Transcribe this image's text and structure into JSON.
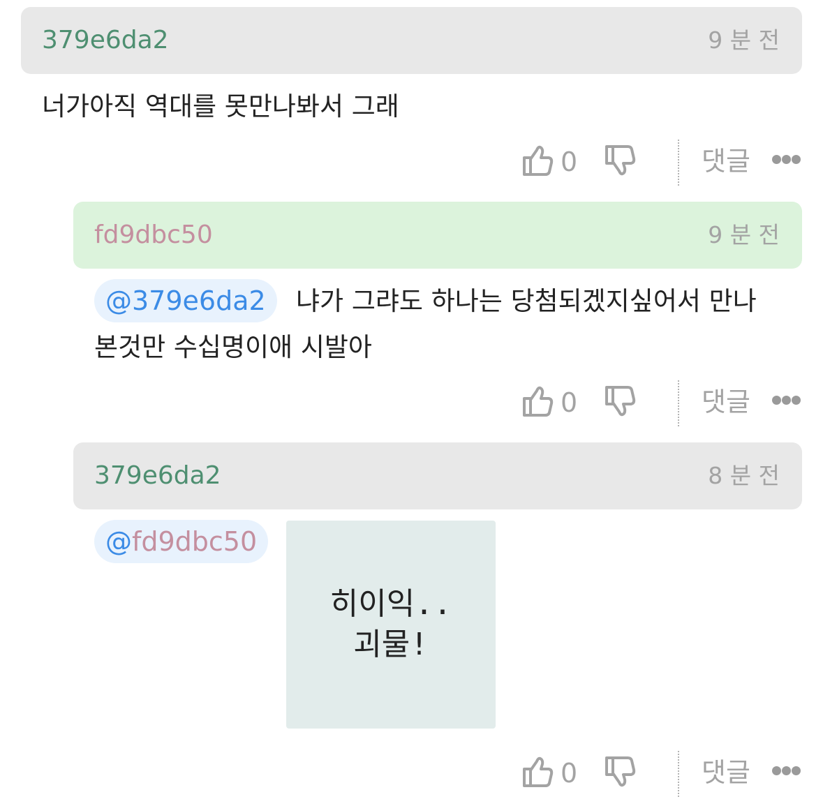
{
  "comments": [
    {
      "author": "379e6da2",
      "time": "9 분 전",
      "text": "너가아직 역대를 못만나봐서 그래",
      "likes": "0",
      "reply_label": "댓글"
    },
    {
      "author": "fd9dbc50",
      "time": "9 분 전",
      "mention_at": "@",
      "mention_name": "379e6da2",
      "text_line1": "냐가 그랴도 하나는 당첨되겠지싶어서 만나",
      "text_line2": "본것만 수십명이애 시발아",
      "likes": "0",
      "reply_label": "댓글"
    },
    {
      "author": "379e6da2",
      "time": "8 분 전",
      "mention_at": "@",
      "mention_name": "fd9dbc50",
      "sticker_line1": "히이익..",
      "sticker_line2": "괴물!",
      "likes": "0",
      "reply_label": "댓글"
    }
  ],
  "icons": {
    "like": "thumbs-up-icon",
    "dislike": "thumbs-down-icon",
    "more": "more-dots-icon"
  },
  "colors": {
    "author_green": "#4e8f71",
    "author_pink": "#c48f9f",
    "mention_blue": "#3b8be6",
    "header_gray": "#e8e8e8",
    "header_green": "#dcf3dc"
  }
}
